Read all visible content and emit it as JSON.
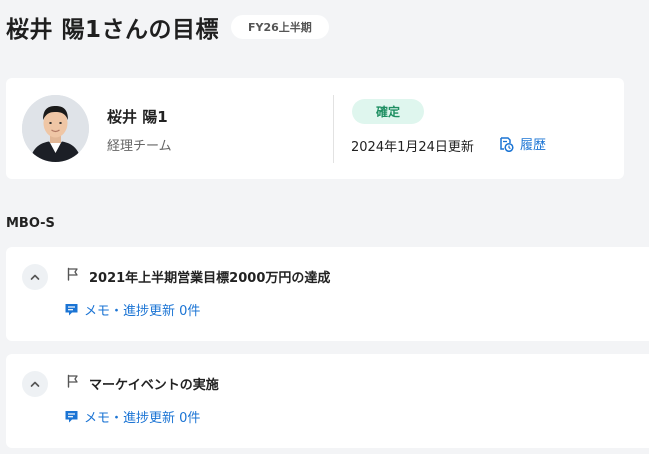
{
  "header": {
    "title": "桜井 陽1さんの目標",
    "period": "FY26上半期"
  },
  "profile": {
    "name": "桜井 陽1",
    "team": "経理チーム",
    "status": "確定",
    "updated": "2024年1月24日更新",
    "history_label": "履歴"
  },
  "section": {
    "title": "MBO-S"
  },
  "goals": [
    {
      "title": "2021年上半期営業目標2000万円の達成",
      "memo_label": "メモ・進捗更新 0件"
    },
    {
      "title": "マーケイベントの実施",
      "memo_label": "メモ・進捗更新 0件"
    }
  ],
  "colors": {
    "accent": "#1b74d4",
    "status_bg": "#dff6ee",
    "status_text": "#1e8f62"
  }
}
